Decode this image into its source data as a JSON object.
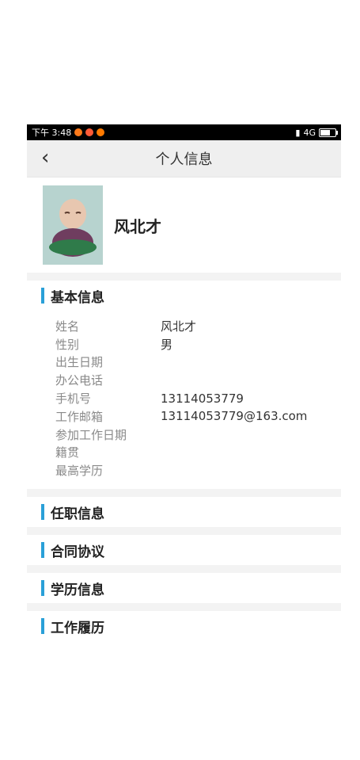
{
  "status": {
    "time": "下午 3:48",
    "network": "4G"
  },
  "header": {
    "title": "个人信息"
  },
  "profile": {
    "name": "风北才"
  },
  "basic_info": {
    "title": "基本信息",
    "rows": [
      {
        "label": "姓名",
        "value": "风北才"
      },
      {
        "label": "性别",
        "value": "男"
      },
      {
        "label": "出生日期",
        "value": ""
      },
      {
        "label": "办公电话",
        "value": ""
      },
      {
        "label": "手机号",
        "value": "13114053779"
      },
      {
        "label": "工作邮箱",
        "value": "13114053779@163.com"
      },
      {
        "label": "参加工作日期",
        "value": ""
      },
      {
        "label": "籍贯",
        "value": ""
      },
      {
        "label": "最高学历",
        "value": ""
      }
    ]
  },
  "sections": [
    {
      "title": "任职信息"
    },
    {
      "title": "合同协议"
    },
    {
      "title": "学历信息"
    },
    {
      "title": "工作履历"
    }
  ],
  "colors": {
    "accent": "#2aa0d8",
    "header_bg": "#efefef",
    "divider": "#f3f3f3"
  }
}
